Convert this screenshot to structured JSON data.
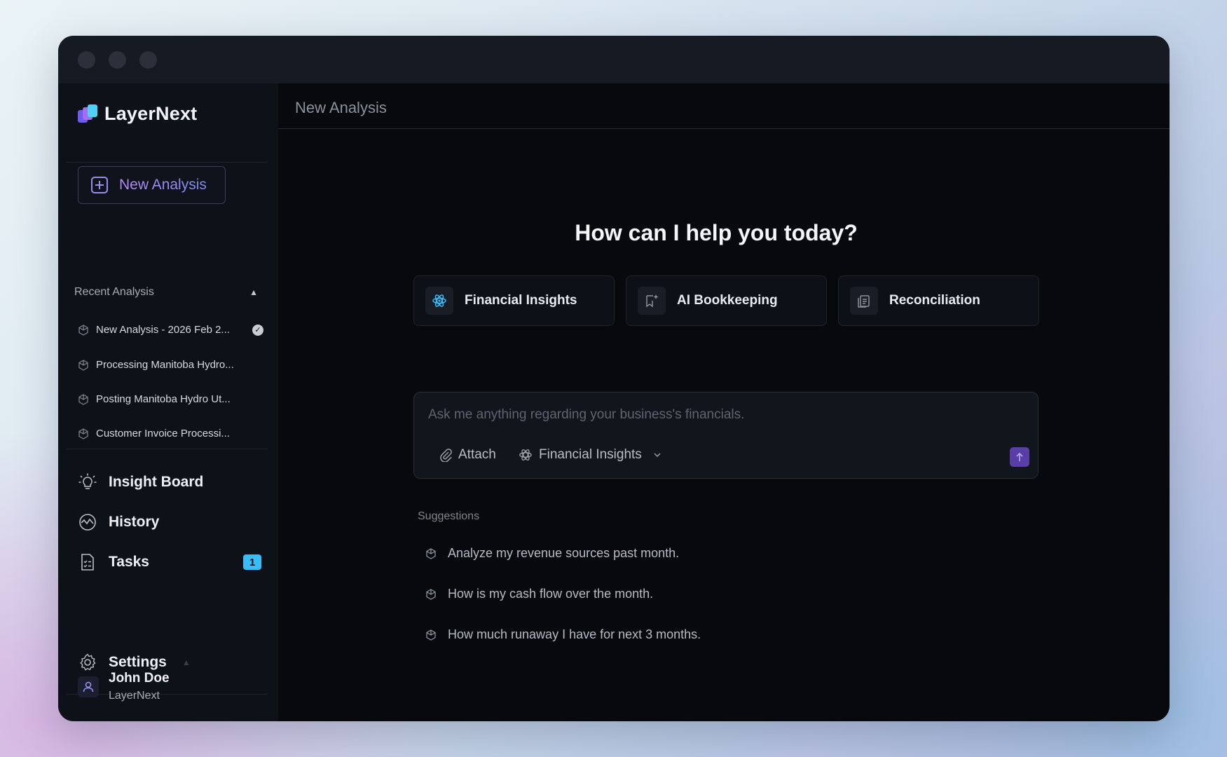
{
  "brand": {
    "name": "LayerNext"
  },
  "sidebar": {
    "new_analysis_label": "New Analysis",
    "recent_title": "Recent Analysis",
    "recent_items": [
      {
        "label": "New Analysis - 2026 Feb 2..."
      },
      {
        "label": "Processing Manitoba Hydro..."
      },
      {
        "label": "Posting Manitoba Hydro Ut..."
      },
      {
        "label": "Customer Invoice Processi..."
      }
    ],
    "nav": {
      "insight_board": "Insight Board",
      "history": "History",
      "tasks": "Tasks",
      "tasks_badge": "1",
      "settings": "Settings"
    },
    "user": {
      "name": "John Doe",
      "org": "LayerNext"
    }
  },
  "main": {
    "title": "New Analysis",
    "hero": "How can I help you today?",
    "cards": [
      {
        "label": "Financial Insights",
        "icon": "atom-icon"
      },
      {
        "label": "AI Bookkeeping",
        "icon": "bookkeeping-icon"
      },
      {
        "label": "Reconciliation",
        "icon": "document-stack-icon"
      }
    ],
    "composer": {
      "placeholder": "Ask me anything regarding your business's financials.",
      "attach_label": "Attach",
      "mode_label": "Financial Insights"
    },
    "suggestions_title": "Suggestions",
    "suggestions": [
      "Analyze my revenue sources past month.",
      "How is my cash flow over the month.",
      "How much runaway I have for next 3 months."
    ]
  },
  "colors": {
    "accent": "#9b8cf0",
    "send_button": "#5a3ea8",
    "badge": "#38bdf8",
    "window_bg": "#0b0e15"
  }
}
